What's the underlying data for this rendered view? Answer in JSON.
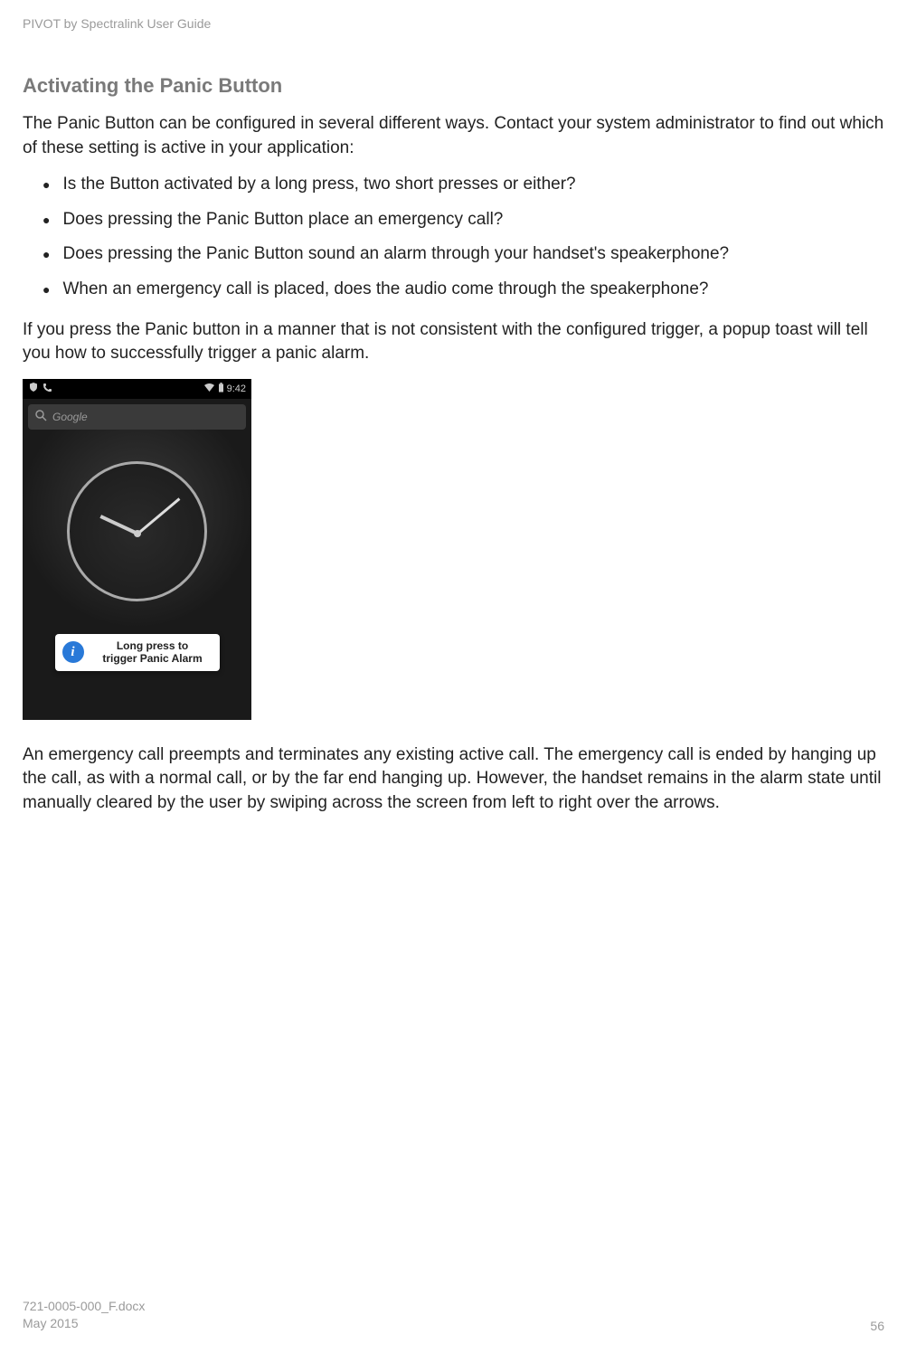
{
  "header": {
    "document_title": "PIVOT by Spectralink User Guide"
  },
  "section": {
    "title": "Activating the Panic Button",
    "intro": "The Panic Button can be configured in several different ways. Contact your system administrator to find out which of these setting is active in your application:",
    "bullets": [
      "Is the Button activated by a long press, two short presses or either?",
      "Does pressing the Panic Button place an emergency call?",
      "Does pressing the Panic Button sound an alarm through your handset's speakerphone?",
      "When an emergency call is placed, does the audio come through the speakerphone?"
    ],
    "para2": "If you press the Panic button in a manner that is not consistent with the configured trigger, a popup toast will tell you how to successfully trigger a panic alarm.",
    "para3": "An emergency call preempts and terminates any existing active call. The emergency call is ended by hanging up the call, as with a normal call, or by the far end hanging up. However, the handset remains in the alarm state until manually cleared by the user by swiping across the screen from left to right over the arrows."
  },
  "screenshot": {
    "status_time": "9:42",
    "search_placeholder": "Google",
    "toast_line1": "Long press to",
    "toast_line2": "trigger Panic Alarm"
  },
  "footer": {
    "doc_id": "721-0005-000_F.docx",
    "date": "May 2015",
    "page": "56"
  }
}
